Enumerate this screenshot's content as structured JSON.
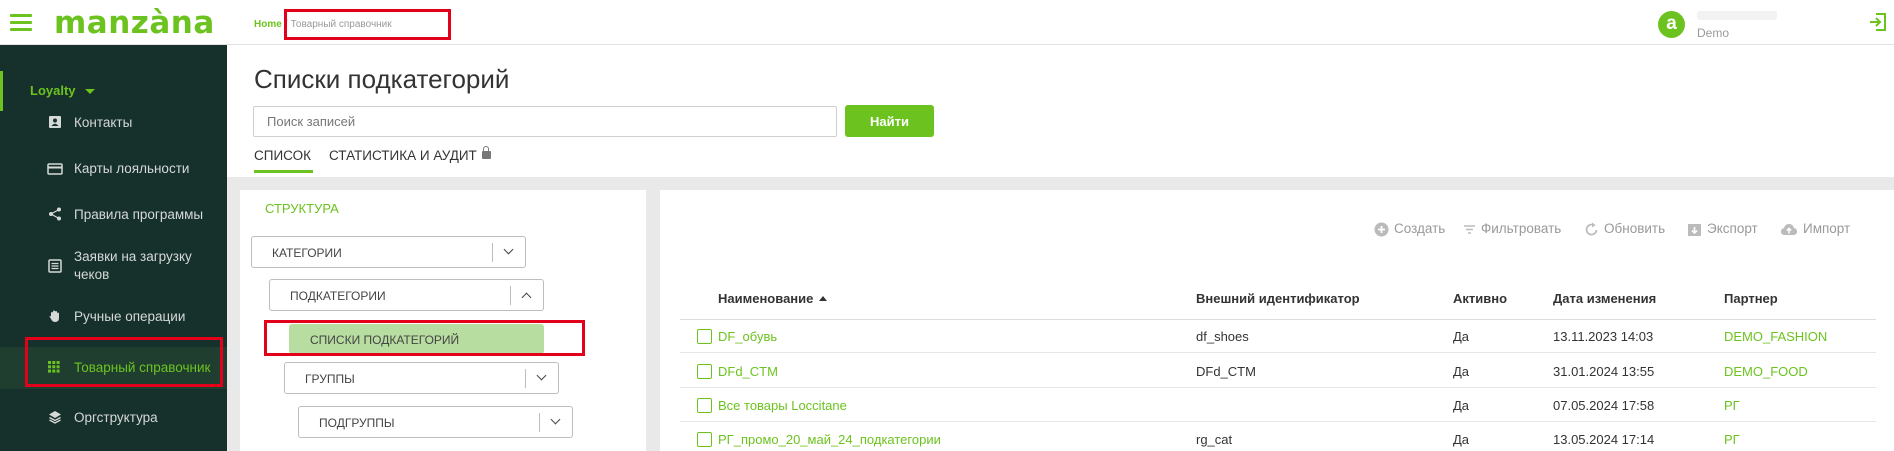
{
  "header": {
    "logo": "manzàna",
    "breadcrumb": {
      "home": "Home",
      "separator": "/",
      "current": "Товарный справочник"
    },
    "user": {
      "avatar_letter": "a",
      "name": "Demo"
    }
  },
  "sidebar": {
    "section": "Loyalty",
    "items": [
      {
        "label": "Контакты",
        "icon": "contact-card-icon"
      },
      {
        "label": "Карты лояльности",
        "icon": "credit-card-icon"
      },
      {
        "label": "Правила программы",
        "icon": "share-nodes-icon"
      },
      {
        "label": "Заявки на загрузку чеков",
        "icon": "receipt-list-icon"
      },
      {
        "label": "Ручные операции",
        "icon": "hand-icon"
      },
      {
        "label": "Товарный справочник",
        "icon": "grid-icon",
        "active": true
      },
      {
        "label": "Оргструктура",
        "icon": "layers-icon"
      }
    ]
  },
  "page": {
    "title": "Списки подкатегорий",
    "search_placeholder": "Поиск записей",
    "find_button": "Найти",
    "tabs": [
      {
        "label": "СПИСОК",
        "active": true
      },
      {
        "label": "СТАТИСТИКА И АУДИТ",
        "locked": true
      }
    ]
  },
  "structure": {
    "title": "СТРУКТУРА",
    "levels": [
      {
        "label": "КАТЕГОРИИ",
        "state": "collapsed"
      },
      {
        "label": "ПОДКАТЕГОРИИ",
        "state": "expanded"
      },
      {
        "label": "СПИСКИ ПОДКАТЕГОРИЙ",
        "state": "selected"
      },
      {
        "label": "ГРУППЫ",
        "state": "collapsed"
      },
      {
        "label": "ПОДГРУППЫ",
        "state": "collapsed"
      }
    ]
  },
  "toolbar": {
    "create": "Создать",
    "filter": "Фильтровать",
    "refresh": "Обновить",
    "export": "Экспорт",
    "import": "Импорт"
  },
  "table": {
    "columns": [
      "Наименование",
      "Внешний идентификатор",
      "Активно",
      "Дата изменения",
      "Партнер"
    ],
    "rows": [
      {
        "name": "DF_обувь",
        "ext_id": "df_shoes",
        "active": "Да",
        "modified": "13.11.2023 14:03",
        "partner": "DEMO_FASHION"
      },
      {
        "name": "DFd_CTM",
        "ext_id": "DFd_CTM",
        "active": "Да",
        "modified": "31.01.2024 13:55",
        "partner": "DEMO_FOOD"
      },
      {
        "name": "Все товары Loccitane",
        "ext_id": "",
        "active": "Да",
        "modified": "07.05.2024 17:58",
        "partner": "РГ"
      },
      {
        "name": "РГ_промо_20_май_24_подкатегории",
        "ext_id": "rg_cat",
        "active": "Да",
        "modified": "13.05.2024 17:14",
        "partner": "РГ"
      }
    ]
  },
  "colors": {
    "accent": "#6cc31f",
    "sidebar_bg": "#16302b",
    "highlight_box": "#e3001b"
  }
}
